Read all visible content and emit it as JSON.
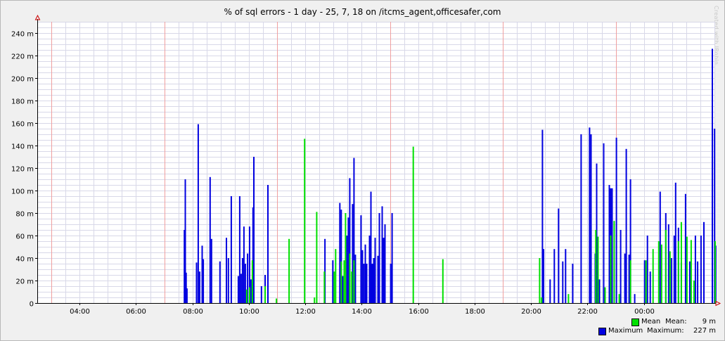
{
  "chart_data": {
    "type": "bar",
    "title": "% of sql errors - 1 day - 25, 7, 18 on /itcms_agent,officesafer,com",
    "watermark": "Created with JRobin",
    "xlabel": "",
    "ylabel": "",
    "ylim": [
      0,
      250
    ],
    "y_ticks": [
      0,
      20,
      40,
      60,
      80,
      100,
      120,
      140,
      160,
      180,
      200,
      220,
      240
    ],
    "y_tick_labels": [
      "0",
      "20 m",
      "40 m",
      "60 m",
      "80 m",
      "100 m",
      "120 m",
      "140 m",
      "160 m",
      "180 m",
      "200 m",
      "220 m",
      "240 m"
    ],
    "x_unit": "hours",
    "xlim": [
      2.5,
      26.5
    ],
    "x_ticks": [
      4,
      6,
      8,
      10,
      12,
      14,
      16,
      18,
      20,
      22,
      24
    ],
    "x_tick_labels": [
      "04:00",
      "06:00",
      "08:00",
      "10:00",
      "12:00",
      "14:00",
      "16:00",
      "18:00",
      "20:00",
      "22:00",
      "00:00"
    ],
    "grid": true,
    "legend_position": "bottom-right",
    "colors": {
      "mean": "#00e000",
      "maximum": "#0000e0",
      "grid_major": "#f0a0a0",
      "grid_minor": "#d8d8e8"
    },
    "series": [
      {
        "name": "Mean",
        "points": [
          [
            7.79,
            0
          ],
          [
            8.16,
            0
          ],
          [
            9.58,
            0
          ],
          [
            9.9,
            12
          ],
          [
            10.0,
            14
          ],
          [
            10.1,
            38
          ],
          [
            10.55,
            15
          ],
          [
            10.95,
            4
          ],
          [
            11.4,
            57
          ],
          [
            11.95,
            146
          ],
          [
            12.3,
            5
          ],
          [
            12.38,
            81
          ],
          [
            12.65,
            28
          ],
          [
            13.0,
            28
          ],
          [
            13.05,
            48
          ],
          [
            13.25,
            37
          ],
          [
            13.35,
            38
          ],
          [
            13.4,
            80
          ],
          [
            13.55,
            44
          ],
          [
            13.62,
            28
          ],
          [
            13.7,
            38
          ],
          [
            15.8,
            139
          ],
          [
            16.85,
            39
          ],
          [
            20.28,
            40
          ],
          [
            20.35,
            5
          ],
          [
            21.3,
            8
          ],
          [
            22.27,
            65
          ],
          [
            22.35,
            59
          ],
          [
            22.6,
            14
          ],
          [
            22.8,
            60
          ],
          [
            22.92,
            73
          ],
          [
            23.1,
            8
          ],
          [
            23.5,
            38
          ],
          [
            24.05,
            38
          ],
          [
            24.3,
            48
          ],
          [
            24.5,
            55
          ],
          [
            24.6,
            52
          ],
          [
            24.75,
            65
          ],
          [
            24.9,
            46
          ],
          [
            25.2,
            55
          ],
          [
            25.3,
            72
          ],
          [
            25.5,
            59
          ],
          [
            25.65,
            56
          ],
          [
            25.75,
            20
          ],
          [
            26.5,
            55
          ]
        ]
      },
      {
        "name": "Maximum",
        "points": [
          [
            7.69,
            65
          ],
          [
            7.72,
            110
          ],
          [
            7.75,
            27
          ],
          [
            7.78,
            13
          ],
          [
            8.12,
            36
          ],
          [
            8.18,
            159
          ],
          [
            8.23,
            28
          ],
          [
            8.32,
            51
          ],
          [
            8.36,
            39
          ],
          [
            8.6,
            112
          ],
          [
            8.65,
            57
          ],
          [
            8.95,
            37
          ],
          [
            9.18,
            58
          ],
          [
            9.25,
            40
          ],
          [
            9.35,
            95
          ],
          [
            9.6,
            24
          ],
          [
            9.65,
            95
          ],
          [
            9.7,
            26
          ],
          [
            9.75,
            40
          ],
          [
            9.8,
            68
          ],
          [
            9.85,
            35
          ],
          [
            9.93,
            44
          ],
          [
            10.0,
            68
          ],
          [
            10.05,
            21
          ],
          [
            10.12,
            85
          ],
          [
            10.15,
            130
          ],
          [
            10.42,
            15
          ],
          [
            10.55,
            25
          ],
          [
            10.65,
            105
          ],
          [
            12.67,
            57
          ],
          [
            12.95,
            38
          ],
          [
            13.2,
            89
          ],
          [
            13.25,
            83
          ],
          [
            13.3,
            24
          ],
          [
            13.45,
            60
          ],
          [
            13.5,
            76
          ],
          [
            13.55,
            111
          ],
          [
            13.65,
            88
          ],
          [
            13.7,
            129
          ],
          [
            13.75,
            43
          ],
          [
            13.95,
            78
          ],
          [
            14.0,
            47
          ],
          [
            14.05,
            35
          ],
          [
            14.1,
            52
          ],
          [
            14.15,
            35
          ],
          [
            14.25,
            60
          ],
          [
            14.3,
            99
          ],
          [
            14.35,
            35
          ],
          [
            14.4,
            40
          ],
          [
            14.45,
            58
          ],
          [
            14.55,
            42
          ],
          [
            14.6,
            80
          ],
          [
            14.7,
            86
          ],
          [
            14.75,
            58
          ],
          [
            14.8,
            70
          ],
          [
            15.0,
            35
          ],
          [
            15.05,
            80
          ],
          [
            20.38,
            154
          ],
          [
            20.42,
            48
          ],
          [
            20.65,
            21
          ],
          [
            20.8,
            48
          ],
          [
            20.95,
            84
          ],
          [
            21.1,
            37
          ],
          [
            21.2,
            48
          ],
          [
            21.45,
            35
          ],
          [
            21.75,
            150
          ],
          [
            22.05,
            156
          ],
          [
            22.1,
            150
          ],
          [
            22.25,
            44
          ],
          [
            22.3,
            124
          ],
          [
            22.4,
            21
          ],
          [
            22.55,
            142
          ],
          [
            22.75,
            105
          ],
          [
            22.8,
            102
          ],
          [
            22.85,
            102
          ],
          [
            23.0,
            147
          ],
          [
            23.15,
            65
          ],
          [
            23.3,
            44
          ],
          [
            23.35,
            137
          ],
          [
            23.45,
            43
          ],
          [
            23.5,
            110
          ],
          [
            23.65,
            8
          ],
          [
            24.0,
            38
          ],
          [
            24.1,
            60
          ],
          [
            24.2,
            28
          ],
          [
            24.55,
            99
          ],
          [
            24.75,
            80
          ],
          [
            24.85,
            70
          ],
          [
            24.95,
            40
          ],
          [
            25.05,
            60
          ],
          [
            25.1,
            107
          ],
          [
            25.2,
            67
          ],
          [
            25.3,
            36
          ],
          [
            25.45,
            97
          ],
          [
            25.6,
            37
          ],
          [
            25.8,
            60
          ],
          [
            25.88,
            37
          ],
          [
            26.0,
            60
          ],
          [
            26.1,
            72
          ],
          [
            26.4,
            226
          ],
          [
            26.48,
            155
          ],
          [
            26.52,
            51
          ],
          [
            26.9,
            57
          ]
        ]
      }
    ],
    "legend": [
      {
        "label": "Mean",
        "stat_label": "Mean:",
        "stat_value": "9 m"
      },
      {
        "label": "Maximum",
        "stat_label": "Maximum:",
        "stat_value": "227 m"
      }
    ]
  }
}
